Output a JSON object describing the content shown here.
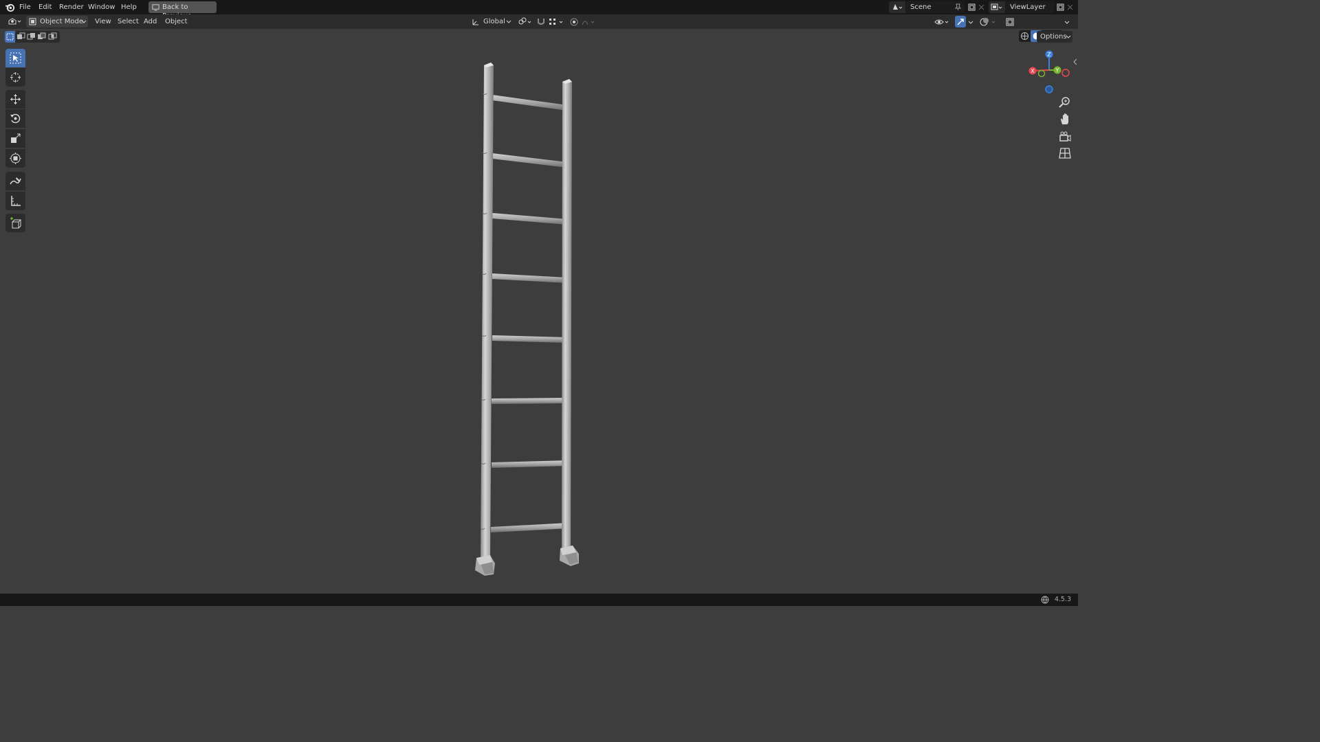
{
  "menubar": {
    "items": [
      "File",
      "Edit",
      "Render",
      "Window",
      "Help"
    ],
    "back_button": "Back to Previous",
    "scene": "Scene",
    "view_layer": "ViewLayer"
  },
  "header": {
    "mode": "Object Mode",
    "menus": [
      "View",
      "Select",
      "Add",
      "Object"
    ],
    "transform_orientation": "Global"
  },
  "viewport": {
    "options_label": "Options",
    "gizmo_axes": [
      "X",
      "Y",
      "Z"
    ],
    "object": "ladder"
  },
  "toolbar": {
    "tools": [
      "select-box",
      "cursor",
      "move",
      "rotate",
      "scale",
      "transform",
      "annotate",
      "measure",
      "add-cube"
    ],
    "active": "select-box"
  },
  "statusbar": {
    "version": "4.5.3"
  },
  "colors": {
    "accent": "#4772b3",
    "background": "#3d3d3d",
    "axis_x": "#e8484f",
    "axis_y": "#79b42c",
    "axis_z": "#3b82e0"
  }
}
